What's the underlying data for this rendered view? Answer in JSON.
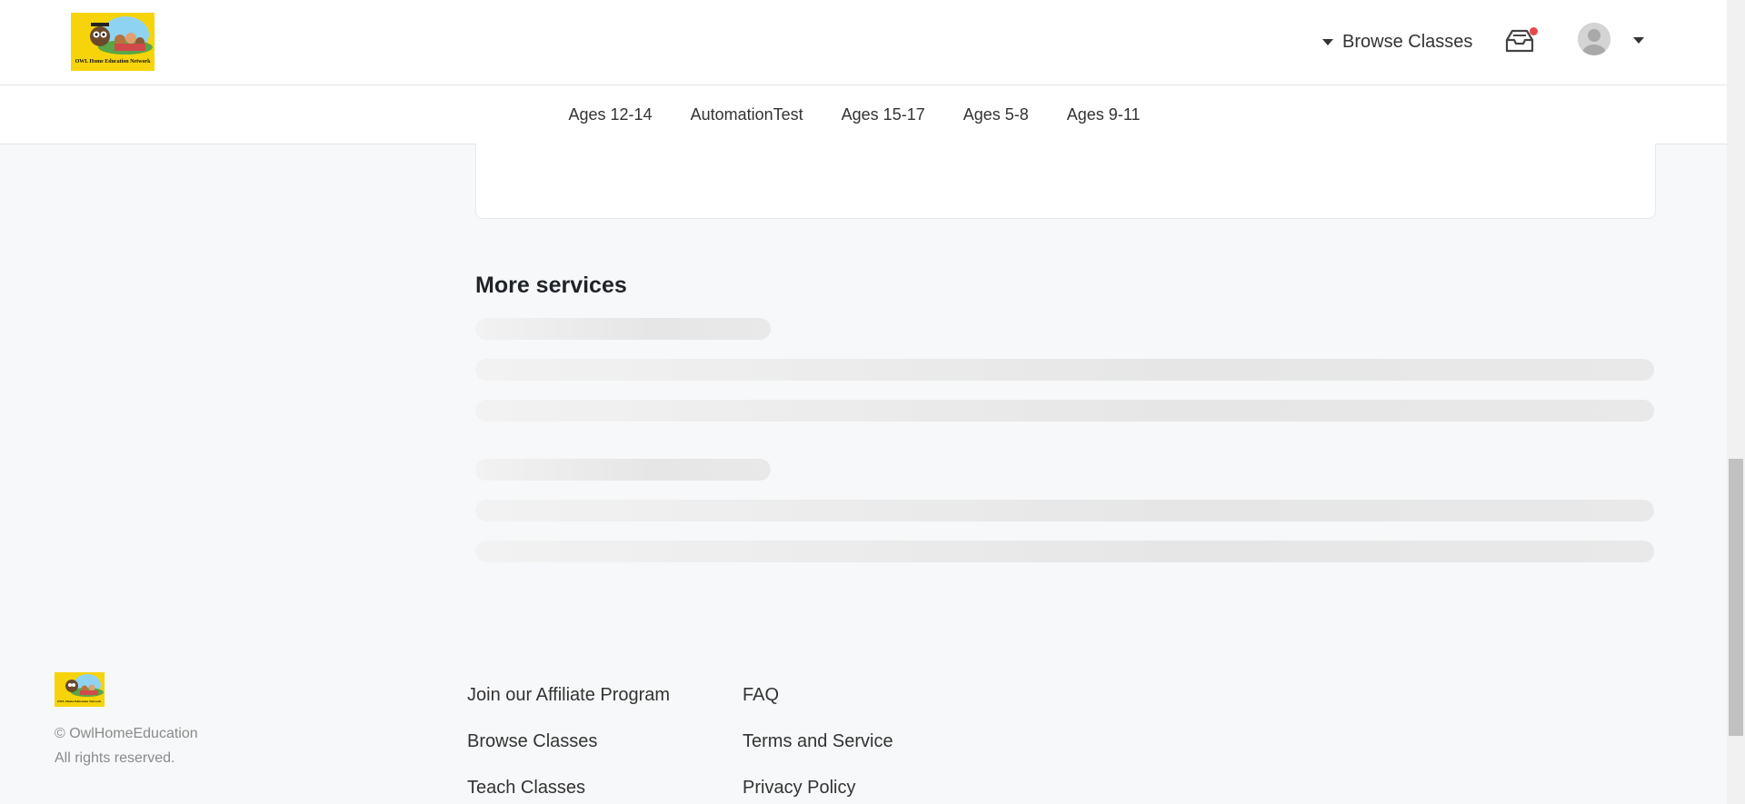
{
  "header": {
    "logo_text": "OWL Home Education Network",
    "browse_label": "Browse Classes",
    "icons": {
      "inbox": "inbox-icon",
      "avatar": "user-avatar-icon",
      "caret": "caret-down-icon"
    },
    "notification_color": "#e5484d"
  },
  "categories": [
    "Ages 12-14",
    "AutomationTest",
    "Ages 15-17",
    "Ages 5-8",
    "Ages 9-11"
  ],
  "main": {
    "section_title": "More services",
    "loading_state": "skeleton"
  },
  "footer": {
    "logo_text": "OWL Home Education Network",
    "copyright": "© OwlHomeEducation",
    "rights": "All rights reserved.",
    "col1": [
      "Join our Affiliate Program",
      "Browse Classes",
      "Teach Classes"
    ],
    "col2": [
      "FAQ",
      "Terms and Service",
      "Privacy Policy"
    ]
  },
  "colors": {
    "brand_yellow": "#f7d40a",
    "page_bg": "#f7f8f9"
  }
}
